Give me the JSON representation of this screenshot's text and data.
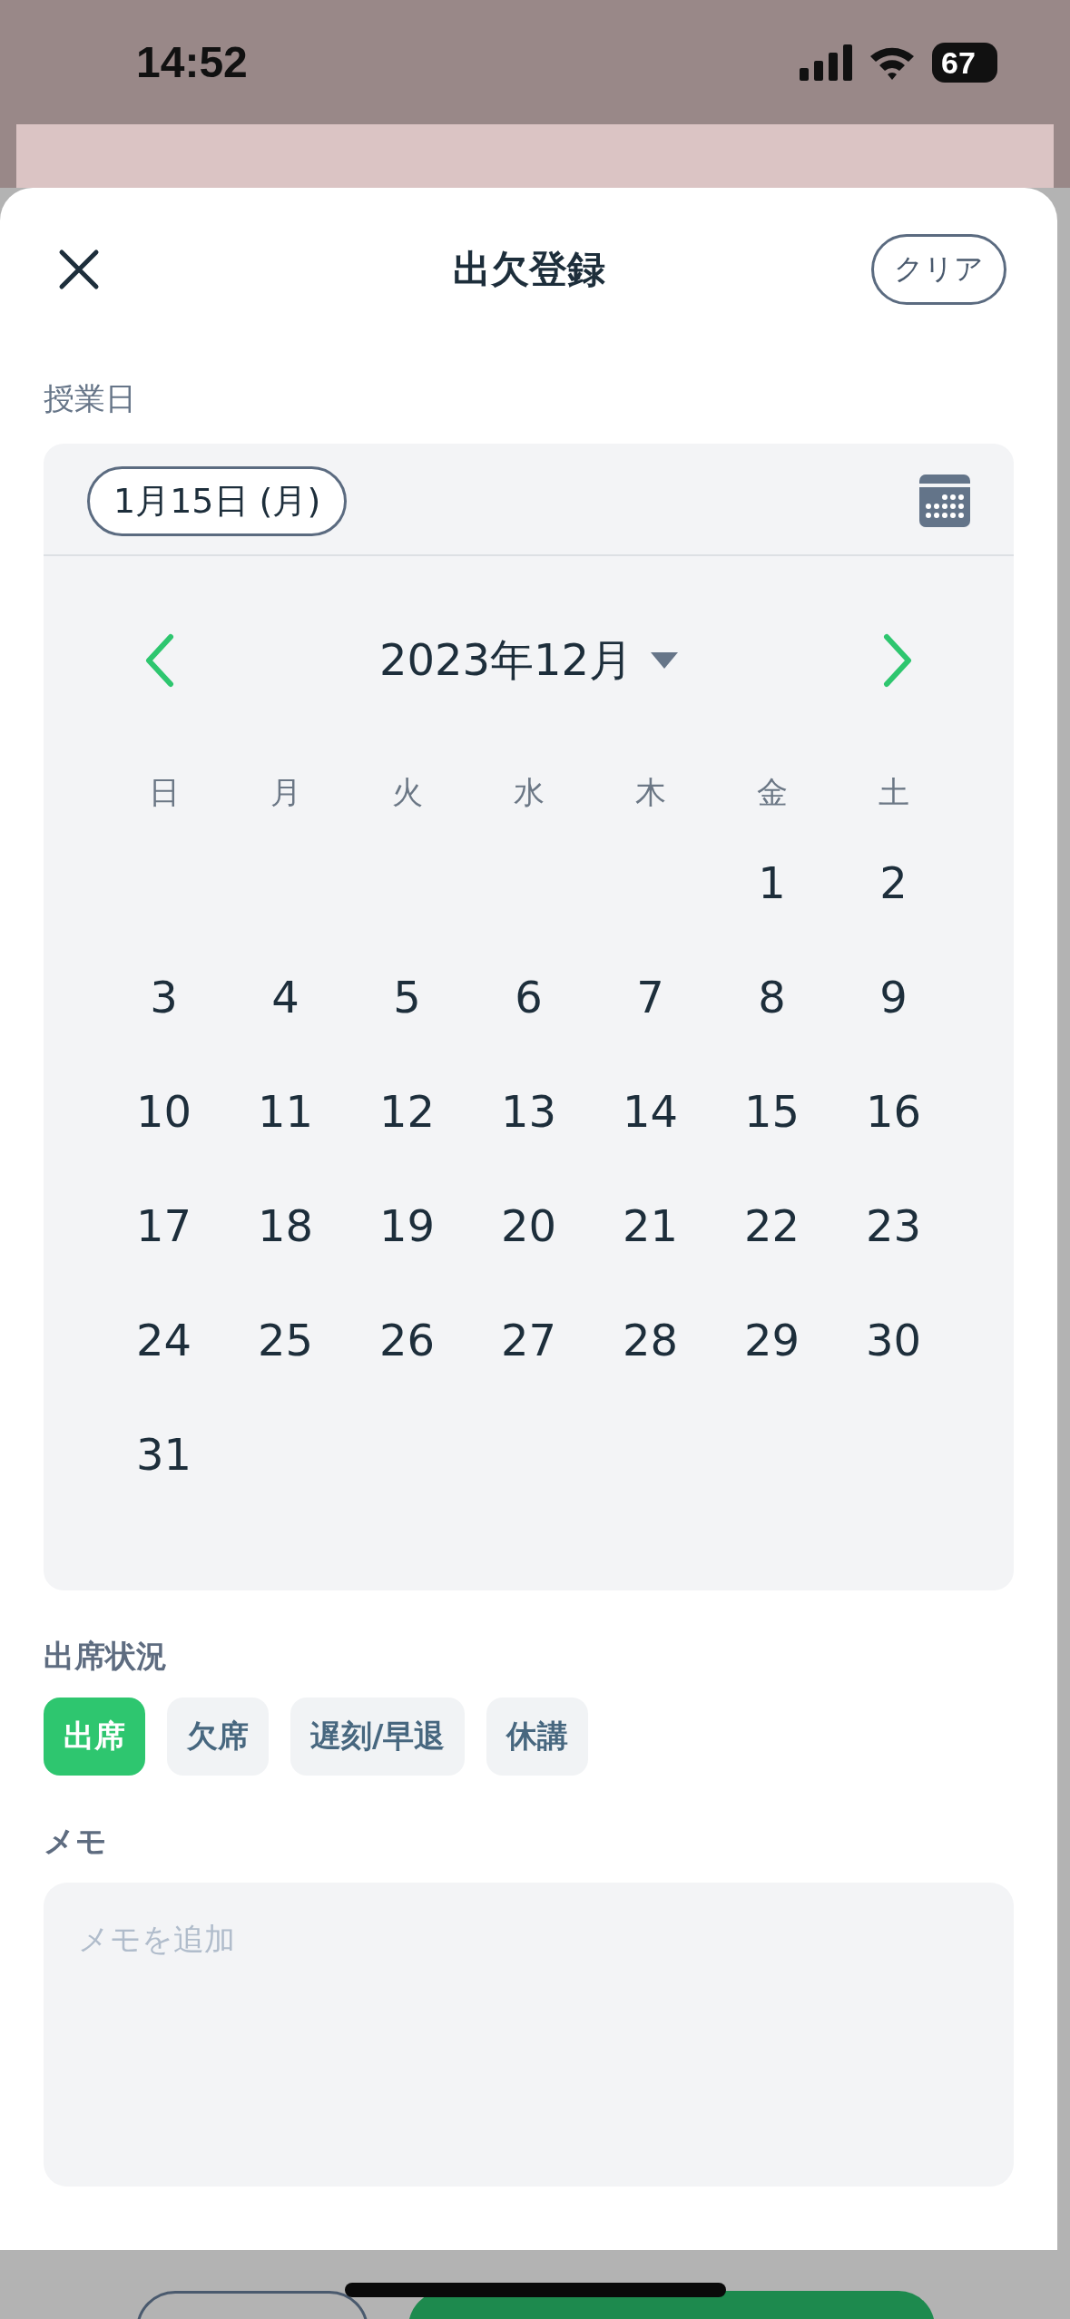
{
  "status_bar": {
    "time": "14:52",
    "battery": "67"
  },
  "header": {
    "title": "出欠登録",
    "clear_button": "クリア"
  },
  "date_section": {
    "label": "授業日",
    "selected_date": "1月15日 (月)"
  },
  "calendar": {
    "month": "2023年12月",
    "weekdays": [
      "日",
      "月",
      "火",
      "水",
      "木",
      "金",
      "土"
    ],
    "weeks": [
      [
        "1",
        "2"
      ],
      [
        "3",
        "4",
        "5",
        "6",
        "7",
        "8",
        "9"
      ],
      [
        "10",
        "11",
        "12",
        "13",
        "14",
        "15",
        "16"
      ],
      [
        "17",
        "18",
        "19",
        "20",
        "21",
        "22",
        "23"
      ],
      [
        "24",
        "25",
        "26",
        "27",
        "28",
        "29",
        "30"
      ],
      [
        "31"
      ]
    ]
  },
  "attendance": {
    "label": "出席状況",
    "options": [
      {
        "label": "出席",
        "selected": true
      },
      {
        "label": "欠席",
        "selected": false
      },
      {
        "label": "遅刻/早退",
        "selected": false
      },
      {
        "label": "休講",
        "selected": false
      }
    ]
  },
  "memo": {
    "label": "メモ",
    "placeholder": "メモを追加"
  }
}
